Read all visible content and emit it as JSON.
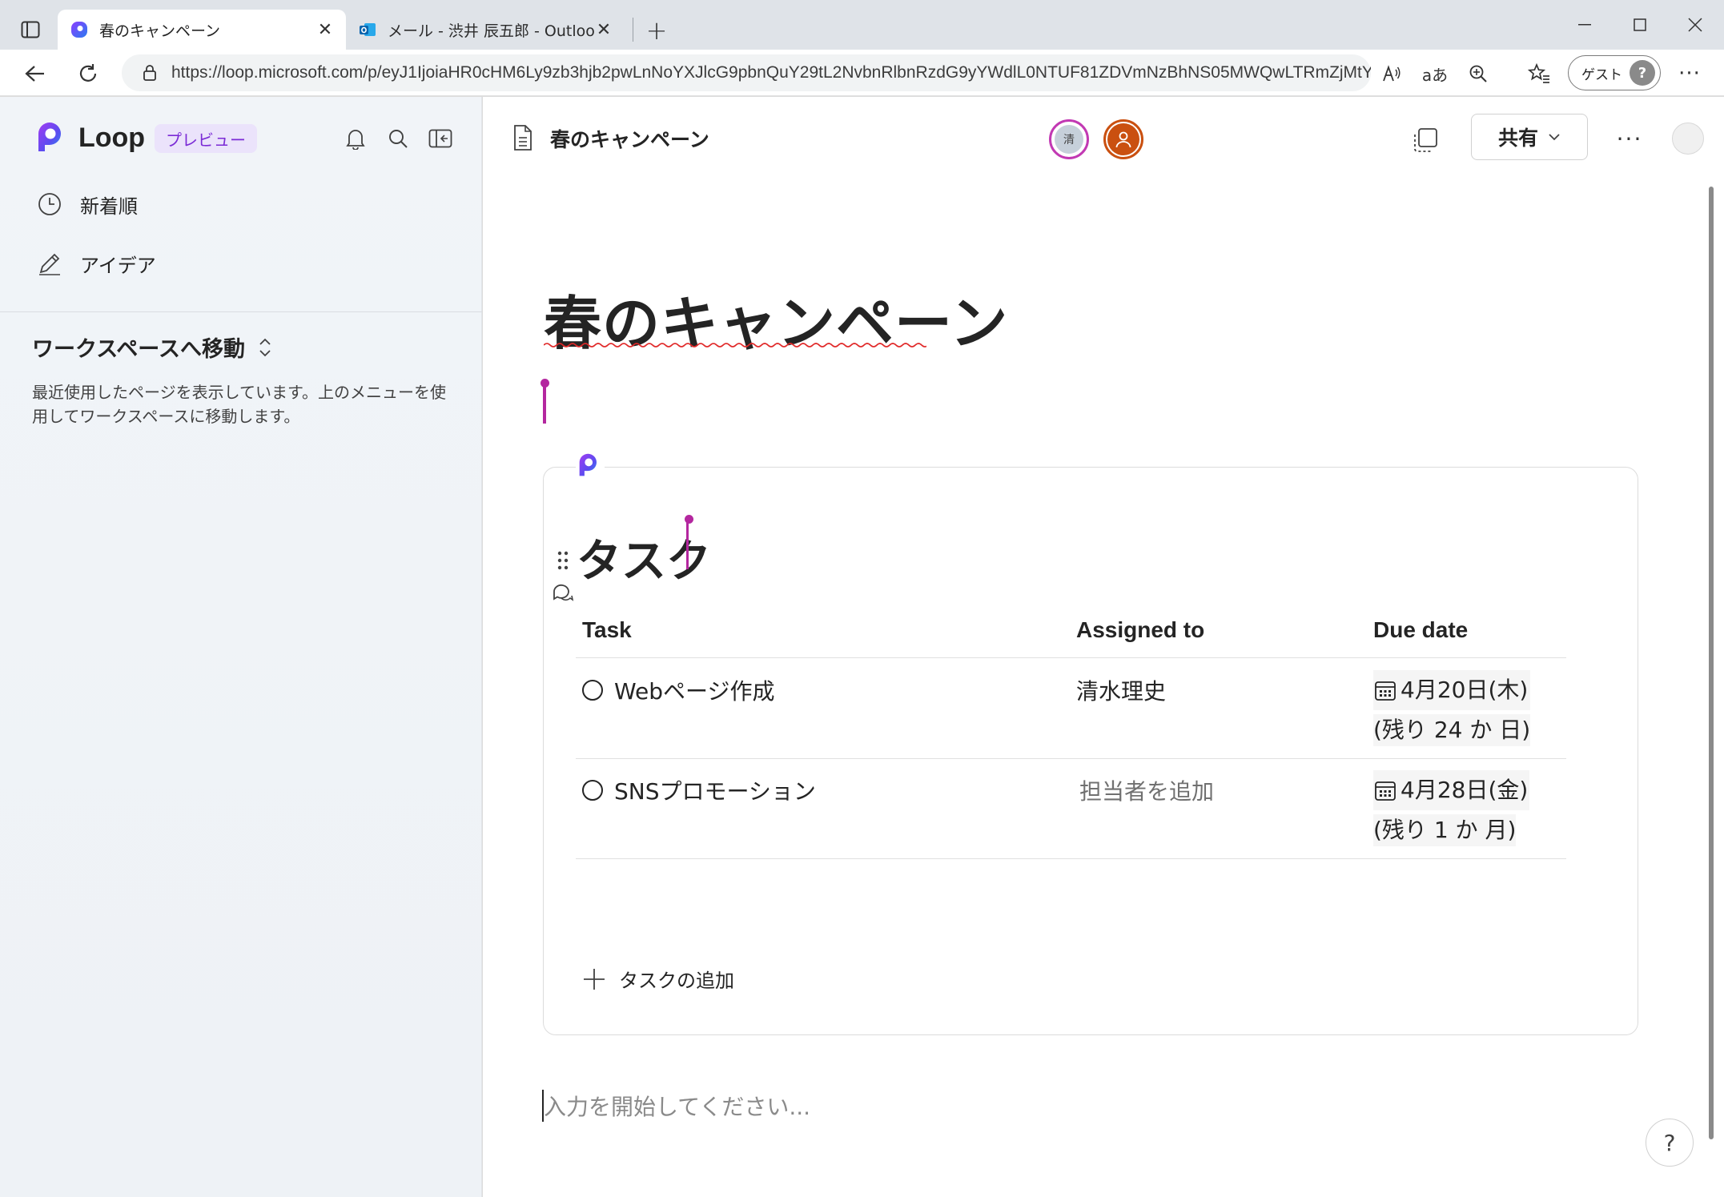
{
  "browser": {
    "tabs": [
      {
        "title": "春のキャンペーン",
        "active": true,
        "icon": "loop-icon"
      },
      {
        "title": "メール - 渋井 辰五郎 - Outlook",
        "active": false,
        "icon": "outlook-icon"
      }
    ],
    "url": "https://loop.microsoft.com/p/eyJ1IjoiaHR0cHM6Ly9zb3hjb2pwLnNoYXJlcG9pbnQuY29tL2NvbnRlbnRzdG9yYWdlL0NTUF81ZDVmNzBhNS05MWQwLTRmZjMtY...",
    "profile_label": "ゲスト",
    "profile_avatar": "?"
  },
  "sidebar": {
    "app_name": "Loop",
    "badge": "プレビュー",
    "items": [
      {
        "label": "新着順",
        "icon": "clock-icon"
      },
      {
        "label": "アイデア",
        "icon": "pencil-icon"
      }
    ],
    "workspace_title": "ワークスペースへ移動",
    "workspace_desc": "最近使用したページを表示しています。上のメニューを使用してワークスペースに移動します。"
  },
  "header": {
    "doc_title": "春のキャンペーン",
    "presence_initial": "清",
    "share_label": "共有"
  },
  "page": {
    "title": "春のキャンペーン",
    "component_title": "タスク",
    "columns": [
      "Task",
      "Assigned to",
      "Due date"
    ],
    "tasks": [
      {
        "task": "Webページ作成",
        "assigned": "清水理史",
        "assigned_placeholder": false,
        "date": "4月20日(木)",
        "remaining": "(残り 24 か 日)"
      },
      {
        "task": "SNSプロモーション",
        "assigned": "担当者を追加",
        "assigned_placeholder": true,
        "date": "4月28日(金)",
        "remaining": "(残り 1 か 月)"
      }
    ],
    "add_task_label": "タスクの追加",
    "input_placeholder": "入力を開始してください...",
    "help_label": "?"
  },
  "colors": {
    "accent_purple": "#7b2bd6",
    "cursor_magenta": "#b4279f",
    "presence_orange": "#ca5010"
  }
}
